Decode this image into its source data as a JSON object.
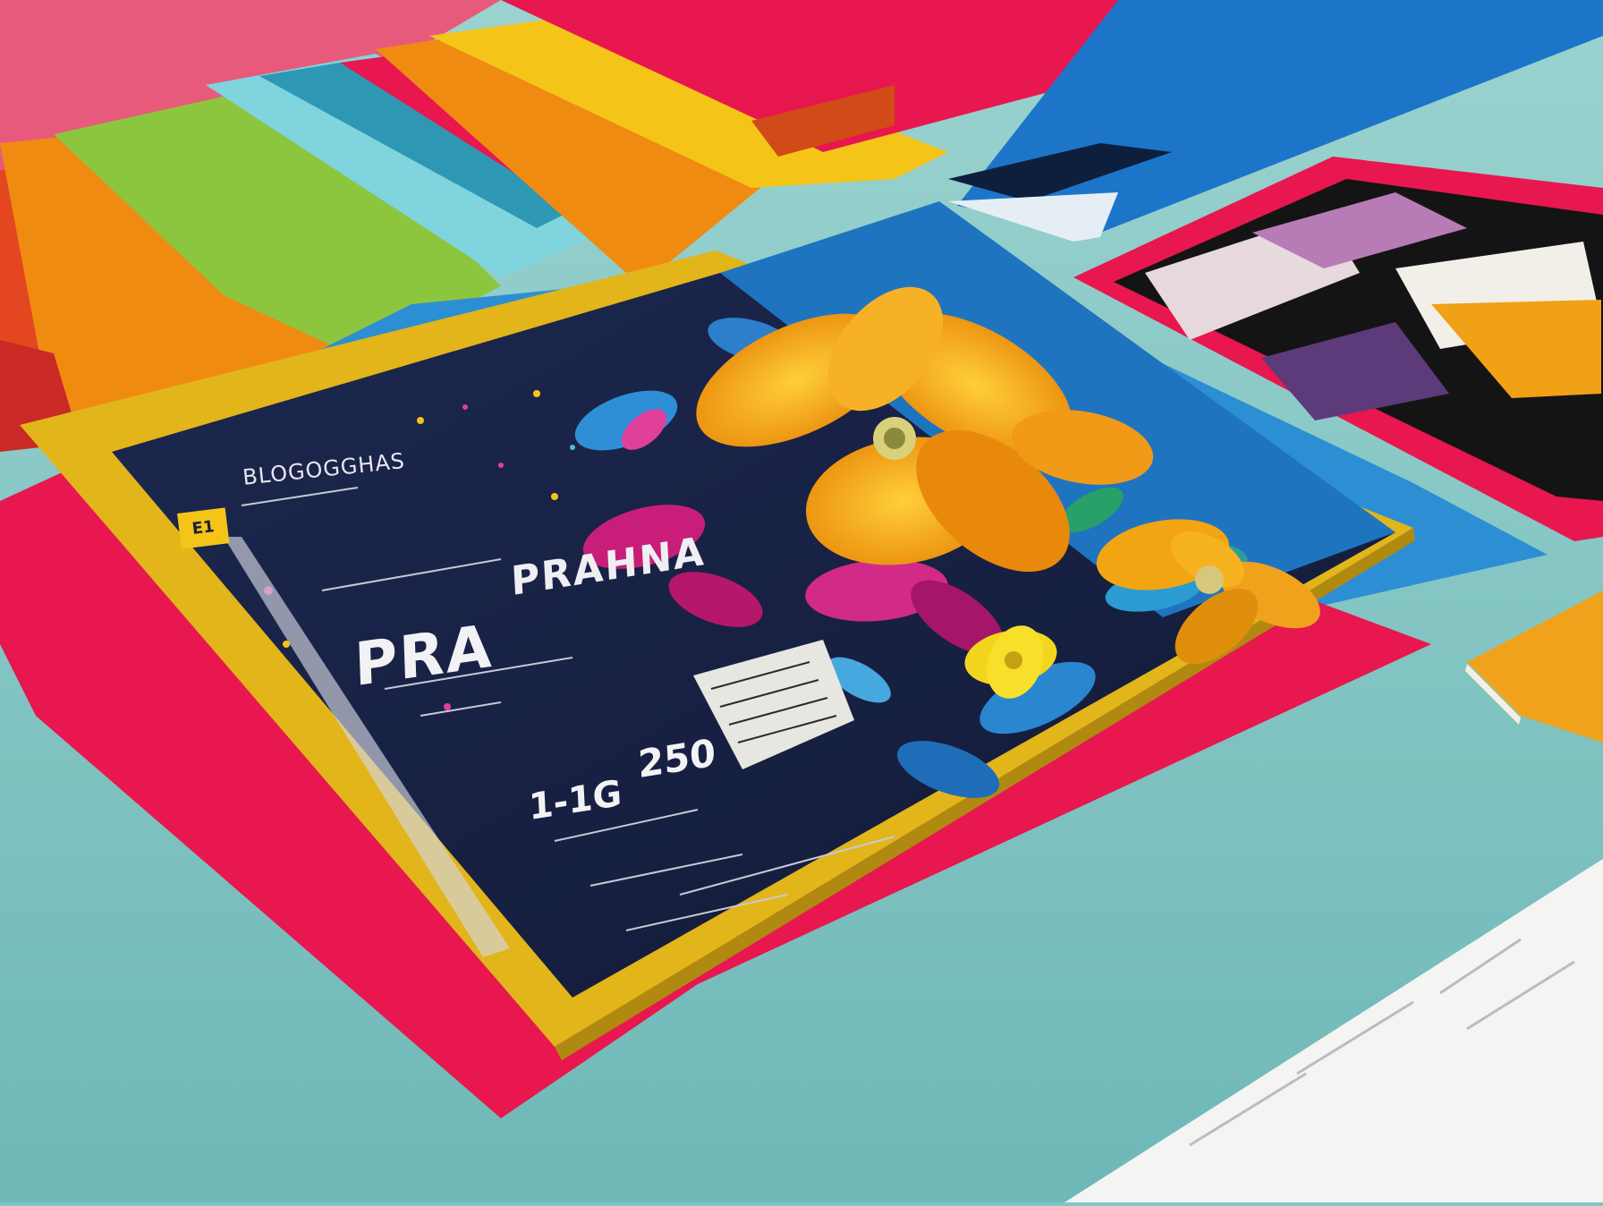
{
  "scene": {
    "background_color": "#7fc6c4",
    "accent_colors": [
      "#e8174f",
      "#f4c518",
      "#1d75c9",
      "#f08b12",
      "#8cc63f"
    ]
  },
  "poster": {
    "brand_text": "BLOGOGGHAS",
    "badge_text": "E1",
    "title": "PRA",
    "headline": "PRAHNA",
    "date": "1-1G",
    "price": "250"
  }
}
